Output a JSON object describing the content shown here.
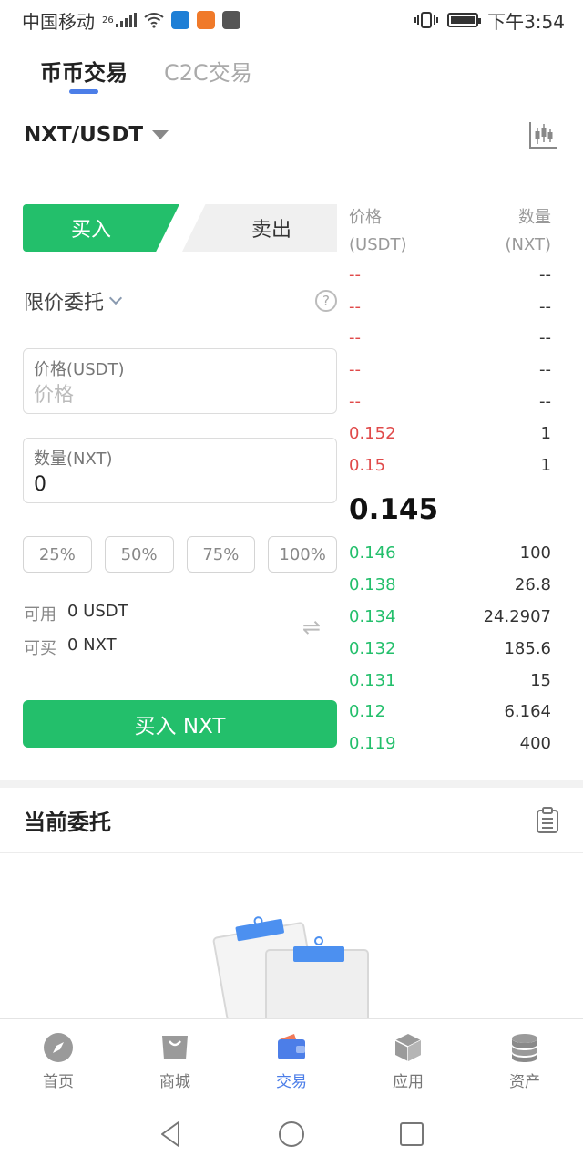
{
  "status_bar": {
    "carrier": "中国移动",
    "network": "26",
    "time": "下午3:54",
    "icons": [
      "signal-icon",
      "wifi-icon",
      "shield-app-icon",
      "browser-app-icon",
      "hms-app-icon",
      "vibrate-icon",
      "battery-icon"
    ]
  },
  "top_tabs": [
    {
      "label": "币币交易",
      "active": true
    },
    {
      "label": "C2C交易",
      "active": false
    }
  ],
  "pair": {
    "name": "NXT/USDT"
  },
  "trade": {
    "buy_label": "买入",
    "sell_label": "卖出",
    "order_type": "限价委托",
    "price_field": {
      "label": "价格(USDT)",
      "placeholder": "价格",
      "value": ""
    },
    "amount_field": {
      "label": "数量(NXT)",
      "value": "0"
    },
    "percents": [
      "25%",
      "50%",
      "75%",
      "100%"
    ],
    "available": {
      "label": "可用",
      "value": "0 USDT"
    },
    "can_buy": {
      "label": "可买",
      "value": "0 NXT"
    },
    "submit_label": "买入 NXT",
    "accent_color": "#23bf6b"
  },
  "orderbook": {
    "price_header": [
      "价格",
      "(USDT)"
    ],
    "qty_header": [
      "数量",
      "(NXT)"
    ],
    "asks": [
      {
        "price": "--",
        "qty": "--"
      },
      {
        "price": "--",
        "qty": "--"
      },
      {
        "price": "--",
        "qty": "--"
      },
      {
        "price": "--",
        "qty": "--"
      },
      {
        "price": "--",
        "qty": "--"
      },
      {
        "price": "0.152",
        "qty": "1"
      },
      {
        "price": "0.15",
        "qty": "1"
      }
    ],
    "last_price": "0.145",
    "bids": [
      {
        "price": "0.146",
        "qty": "100"
      },
      {
        "price": "0.138",
        "qty": "26.8"
      },
      {
        "price": "0.134",
        "qty": "24.2907"
      },
      {
        "price": "0.132",
        "qty": "185.6"
      },
      {
        "price": "0.131",
        "qty": "15"
      },
      {
        "price": "0.12",
        "qty": "6.164"
      },
      {
        "price": "0.119",
        "qty": "400"
      }
    ],
    "ask_color": "#e04a4a",
    "bid_color": "#23bf6b"
  },
  "current_orders": {
    "title": "当前委托"
  },
  "bottom_nav": [
    {
      "label": "首页",
      "icon": "compass-icon",
      "active": false
    },
    {
      "label": "商城",
      "icon": "shopping-bag-icon",
      "active": false
    },
    {
      "label": "交易",
      "icon": "wallet-icon",
      "active": true
    },
    {
      "label": "应用",
      "icon": "cube-icon",
      "active": false
    },
    {
      "label": "资产",
      "icon": "coins-icon",
      "active": false
    }
  ]
}
